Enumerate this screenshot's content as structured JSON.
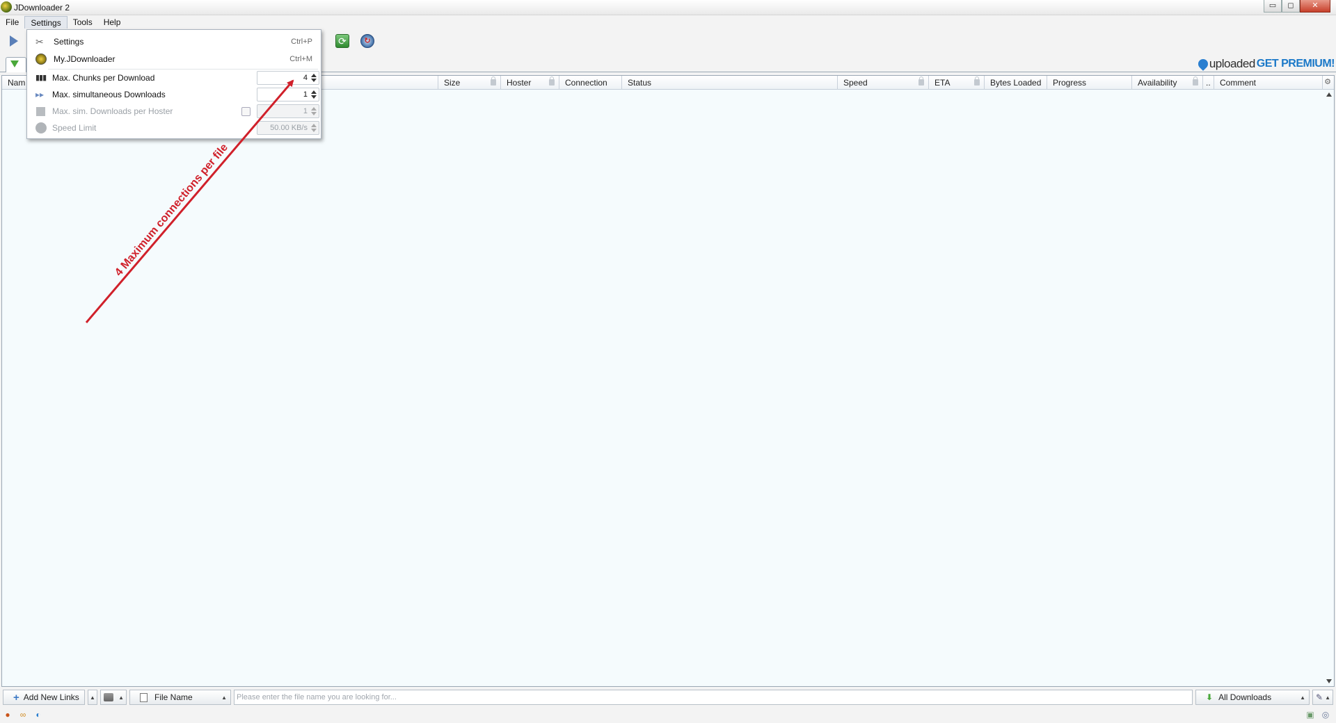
{
  "window": {
    "title": "JDownloader 2",
    "controls": {
      "minimize": "▭",
      "maximize": "◻",
      "close": "✕"
    }
  },
  "menubar": {
    "items": [
      "File",
      "Settings",
      "Tools",
      "Help"
    ],
    "active": "Settings"
  },
  "settings_menu": {
    "items": [
      {
        "label": "Settings",
        "shortcut": "Ctrl+P",
        "icon": "wrench-icon"
      },
      {
        "label": "My.JDownloader",
        "shortcut": "Ctrl+M",
        "icon": "myjd-icon"
      }
    ],
    "controls": [
      {
        "label": "Max. Chunks per Download",
        "value": "4",
        "enabled": true,
        "icon": "chunks-icon"
      },
      {
        "label": "Max. simultaneous Downloads",
        "value": "1",
        "enabled": true,
        "icon": "simultaneous-icon"
      },
      {
        "label": "Max. sim. Downloads per Hoster",
        "value": "1",
        "enabled": false,
        "icon": "hoster-icon"
      },
      {
        "label": "Speed Limit",
        "value": "50.00 KB/s",
        "enabled": false,
        "icon": "speed-icon"
      }
    ]
  },
  "banner": {
    "brand": "uploaded",
    "cta": "GET PREMIUM!"
  },
  "table": {
    "columns": [
      {
        "label": "Nam",
        "locked": false
      },
      {
        "label": "Size",
        "locked": true
      },
      {
        "label": "Hoster",
        "locked": true
      },
      {
        "label": "Connection",
        "locked": false
      },
      {
        "label": "Status",
        "locked": false
      },
      {
        "label": "Speed",
        "locked": true
      },
      {
        "label": "ETA",
        "locked": true
      },
      {
        "label": "Bytes Loaded",
        "locked": false
      },
      {
        "label": "Progress",
        "locked": false
      },
      {
        "label": "Availability",
        "locked": true
      },
      {
        "label": "..",
        "locked": false
      },
      {
        "label": "Comment",
        "locked": false
      }
    ]
  },
  "bottombar": {
    "add_links": "Add New Links",
    "filter_field": "File Name",
    "search_placeholder": "Please enter the file name you are looking for...",
    "view_filter": "All Downloads"
  },
  "annotation": {
    "text": "4 Maximum connections per file",
    "color": "#d0202a"
  },
  "colors": {
    "table_bg": "#f5fbfd",
    "accent_blue": "#1a78c8",
    "toolbar_green": "#4aa83a"
  }
}
